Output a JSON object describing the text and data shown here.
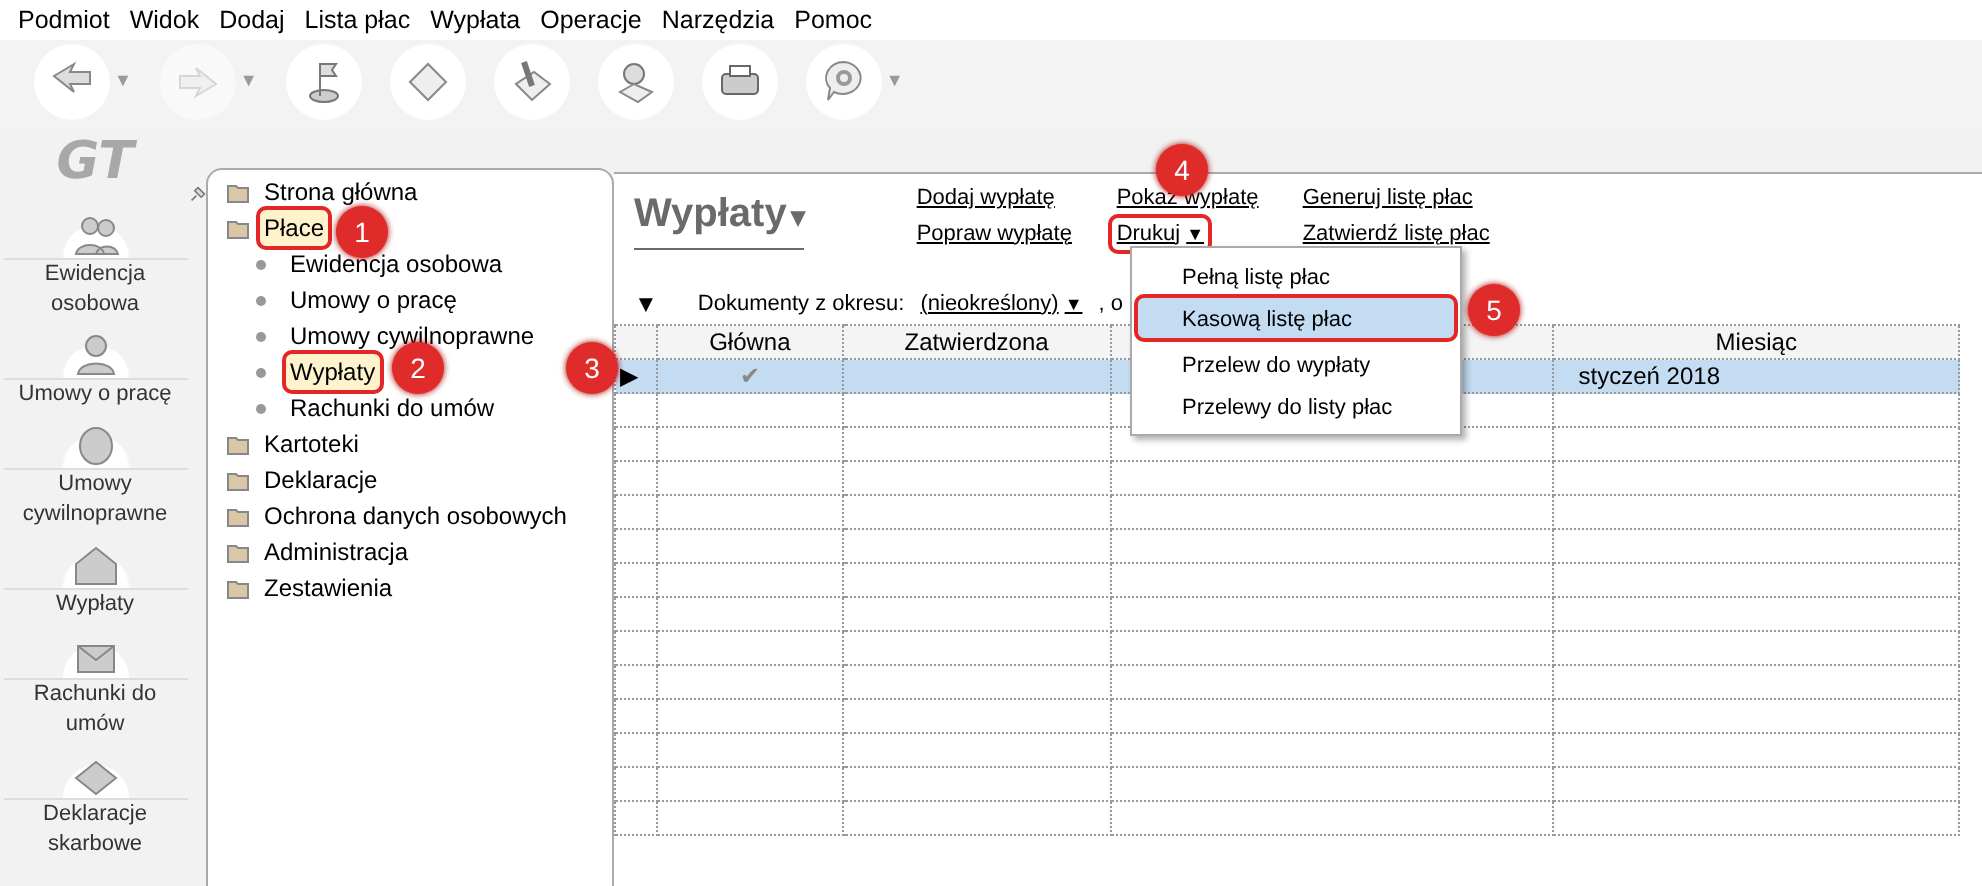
{
  "menu_bar": [
    "Podmiot",
    "Widok",
    "Dodaj",
    "Lista płac",
    "Wypłata",
    "Operacje",
    "Narzędzia",
    "Pomoc"
  ],
  "toolbar": [
    {
      "caret": "▼",
      "disabled": false
    },
    {
      "caret": "▼",
      "disabled": true
    },
    {
      "disabled": false
    },
    {
      "disabled": false
    },
    {
      "disabled": false
    },
    {
      "disabled": false
    },
    {
      "disabled": false
    },
    {
      "caret": "▼",
      "disabled": false
    }
  ],
  "logo": "GT",
  "side_nav": [
    "Ewidencja osobowa",
    "Umowy o pracę",
    "Umowy cywilnoprawne",
    "Wypłaty",
    "Rachunki do umów",
    "Deklaracje skarbowe"
  ],
  "tree": [
    {
      "label": "Strona główna",
      "marked": false
    },
    {
      "label": "Płace",
      "marked": true,
      "children": [
        {
          "label": "Ewidencja osobowa",
          "marked": false
        },
        {
          "label": "Umowy o pracę",
          "marked": false
        },
        {
          "label": "Umowy cywilnoprawne",
          "marked": false
        },
        {
          "label": "Wypłaty",
          "marked": true
        },
        {
          "label": "Rachunki do umów",
          "marked": false
        }
      ]
    },
    {
      "label": "Kartoteki",
      "marked": false
    },
    {
      "label": "Deklaracje",
      "marked": false
    },
    {
      "label": "Ochrona danych osobowych",
      "marked": false
    },
    {
      "label": "Administracja",
      "marked": false
    },
    {
      "label": "Zestawienia",
      "marked": false
    }
  ],
  "page_title": "Wypłaty",
  "page_title_caret": "▾",
  "actions": [
    {
      "label": "Dodaj wypłatę",
      "kind": "link",
      "marked": false
    },
    {
      "label": "Popraw wypłatę",
      "kind": "link",
      "marked": false
    },
    {
      "label": "Pokaż wypłatę",
      "kind": "link",
      "marked": false
    },
    {
      "label": "Drukuj",
      "kind": "dropdown",
      "caret": "▼",
      "marked": true
    },
    {
      "label": "Generuj listę płac",
      "kind": "link",
      "marked": false
    },
    {
      "label": "Zatwierdź listę płac",
      "kind": "link",
      "marked": false
    }
  ],
  "filter": {
    "toggle": "▼",
    "label": "Dokumenty z okresu:",
    "value": "(nieokreślony)",
    "caret": "▼",
    "after": ", o"
  },
  "print_menu": [
    {
      "label": "Pełną listę płac",
      "selected": false,
      "marked": false
    },
    {
      "label": "Kasową listę płac",
      "selected": true,
      "marked": true
    },
    {
      "label": "Przelew do wypłaty",
      "selected": false,
      "marked": false
    },
    {
      "label": "Przelewy do listy płac",
      "selected": false,
      "marked": false
    }
  ],
  "table": {
    "columns": [
      "Główna",
      "Zatwierdzona",
      "",
      "Miesiąc"
    ],
    "rows": [
      {
        "selected": true,
        "pointer": "▶",
        "main": "✔",
        "month": "styczeń 2018"
      }
    ]
  },
  "callouts": [
    "1",
    "2",
    "3",
    "4",
    "5"
  ]
}
